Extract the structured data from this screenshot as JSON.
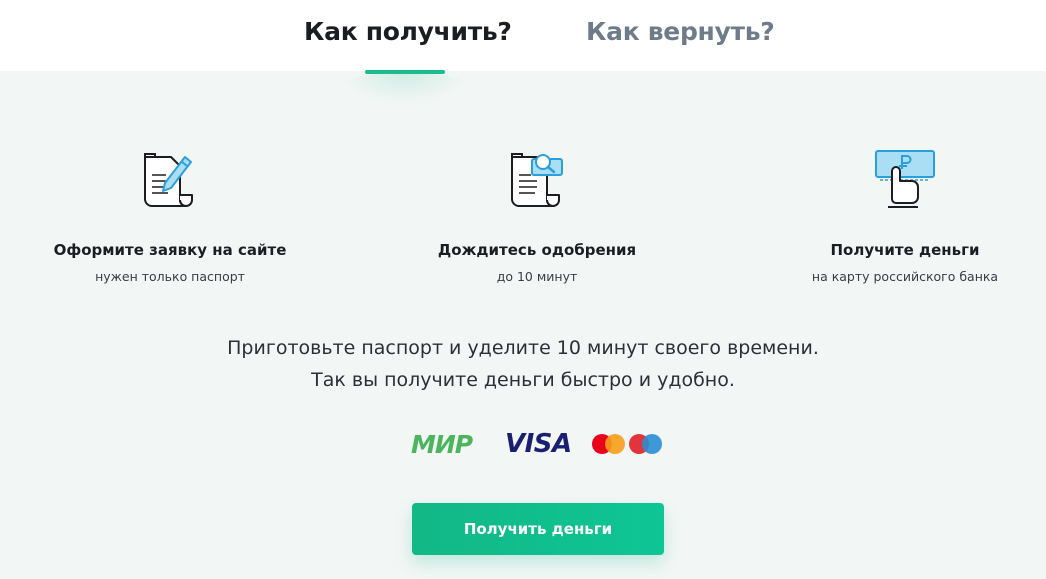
{
  "tabs": [
    {
      "label": "Как получить?",
      "active": true
    },
    {
      "label": "Как вернуть?",
      "active": false
    }
  ],
  "steps": [
    {
      "title": "Оформите заявку на сайте",
      "subtitle": "нужен только паспорт",
      "icon": "document-pen-icon"
    },
    {
      "title": "Дождитесь одобрения",
      "subtitle": "до 10 минут",
      "icon": "document-search-icon"
    },
    {
      "title": "Получите деньги",
      "subtitle": "на карту российского банка",
      "icon": "card-ruble-hand-icon"
    }
  ],
  "info": {
    "line1": "Приготовьте паспорт и уделите 10 минут своего времени.",
    "line2": "Так вы получите деньги быстро и удобно."
  },
  "payment_systems": {
    "mir": "МИР",
    "visa": "VISA",
    "mastercard": "mastercard-logo"
  },
  "cta": {
    "label": "Получить деньги"
  },
  "colors": {
    "accent": "#12b886",
    "text": "#1b1d22",
    "muted_tab": "#6e7c8a",
    "background": "#f2f6f5",
    "icon_highlight": "#a9def5",
    "mir_green": "#4db45e",
    "visa_blue": "#1a1f71"
  }
}
